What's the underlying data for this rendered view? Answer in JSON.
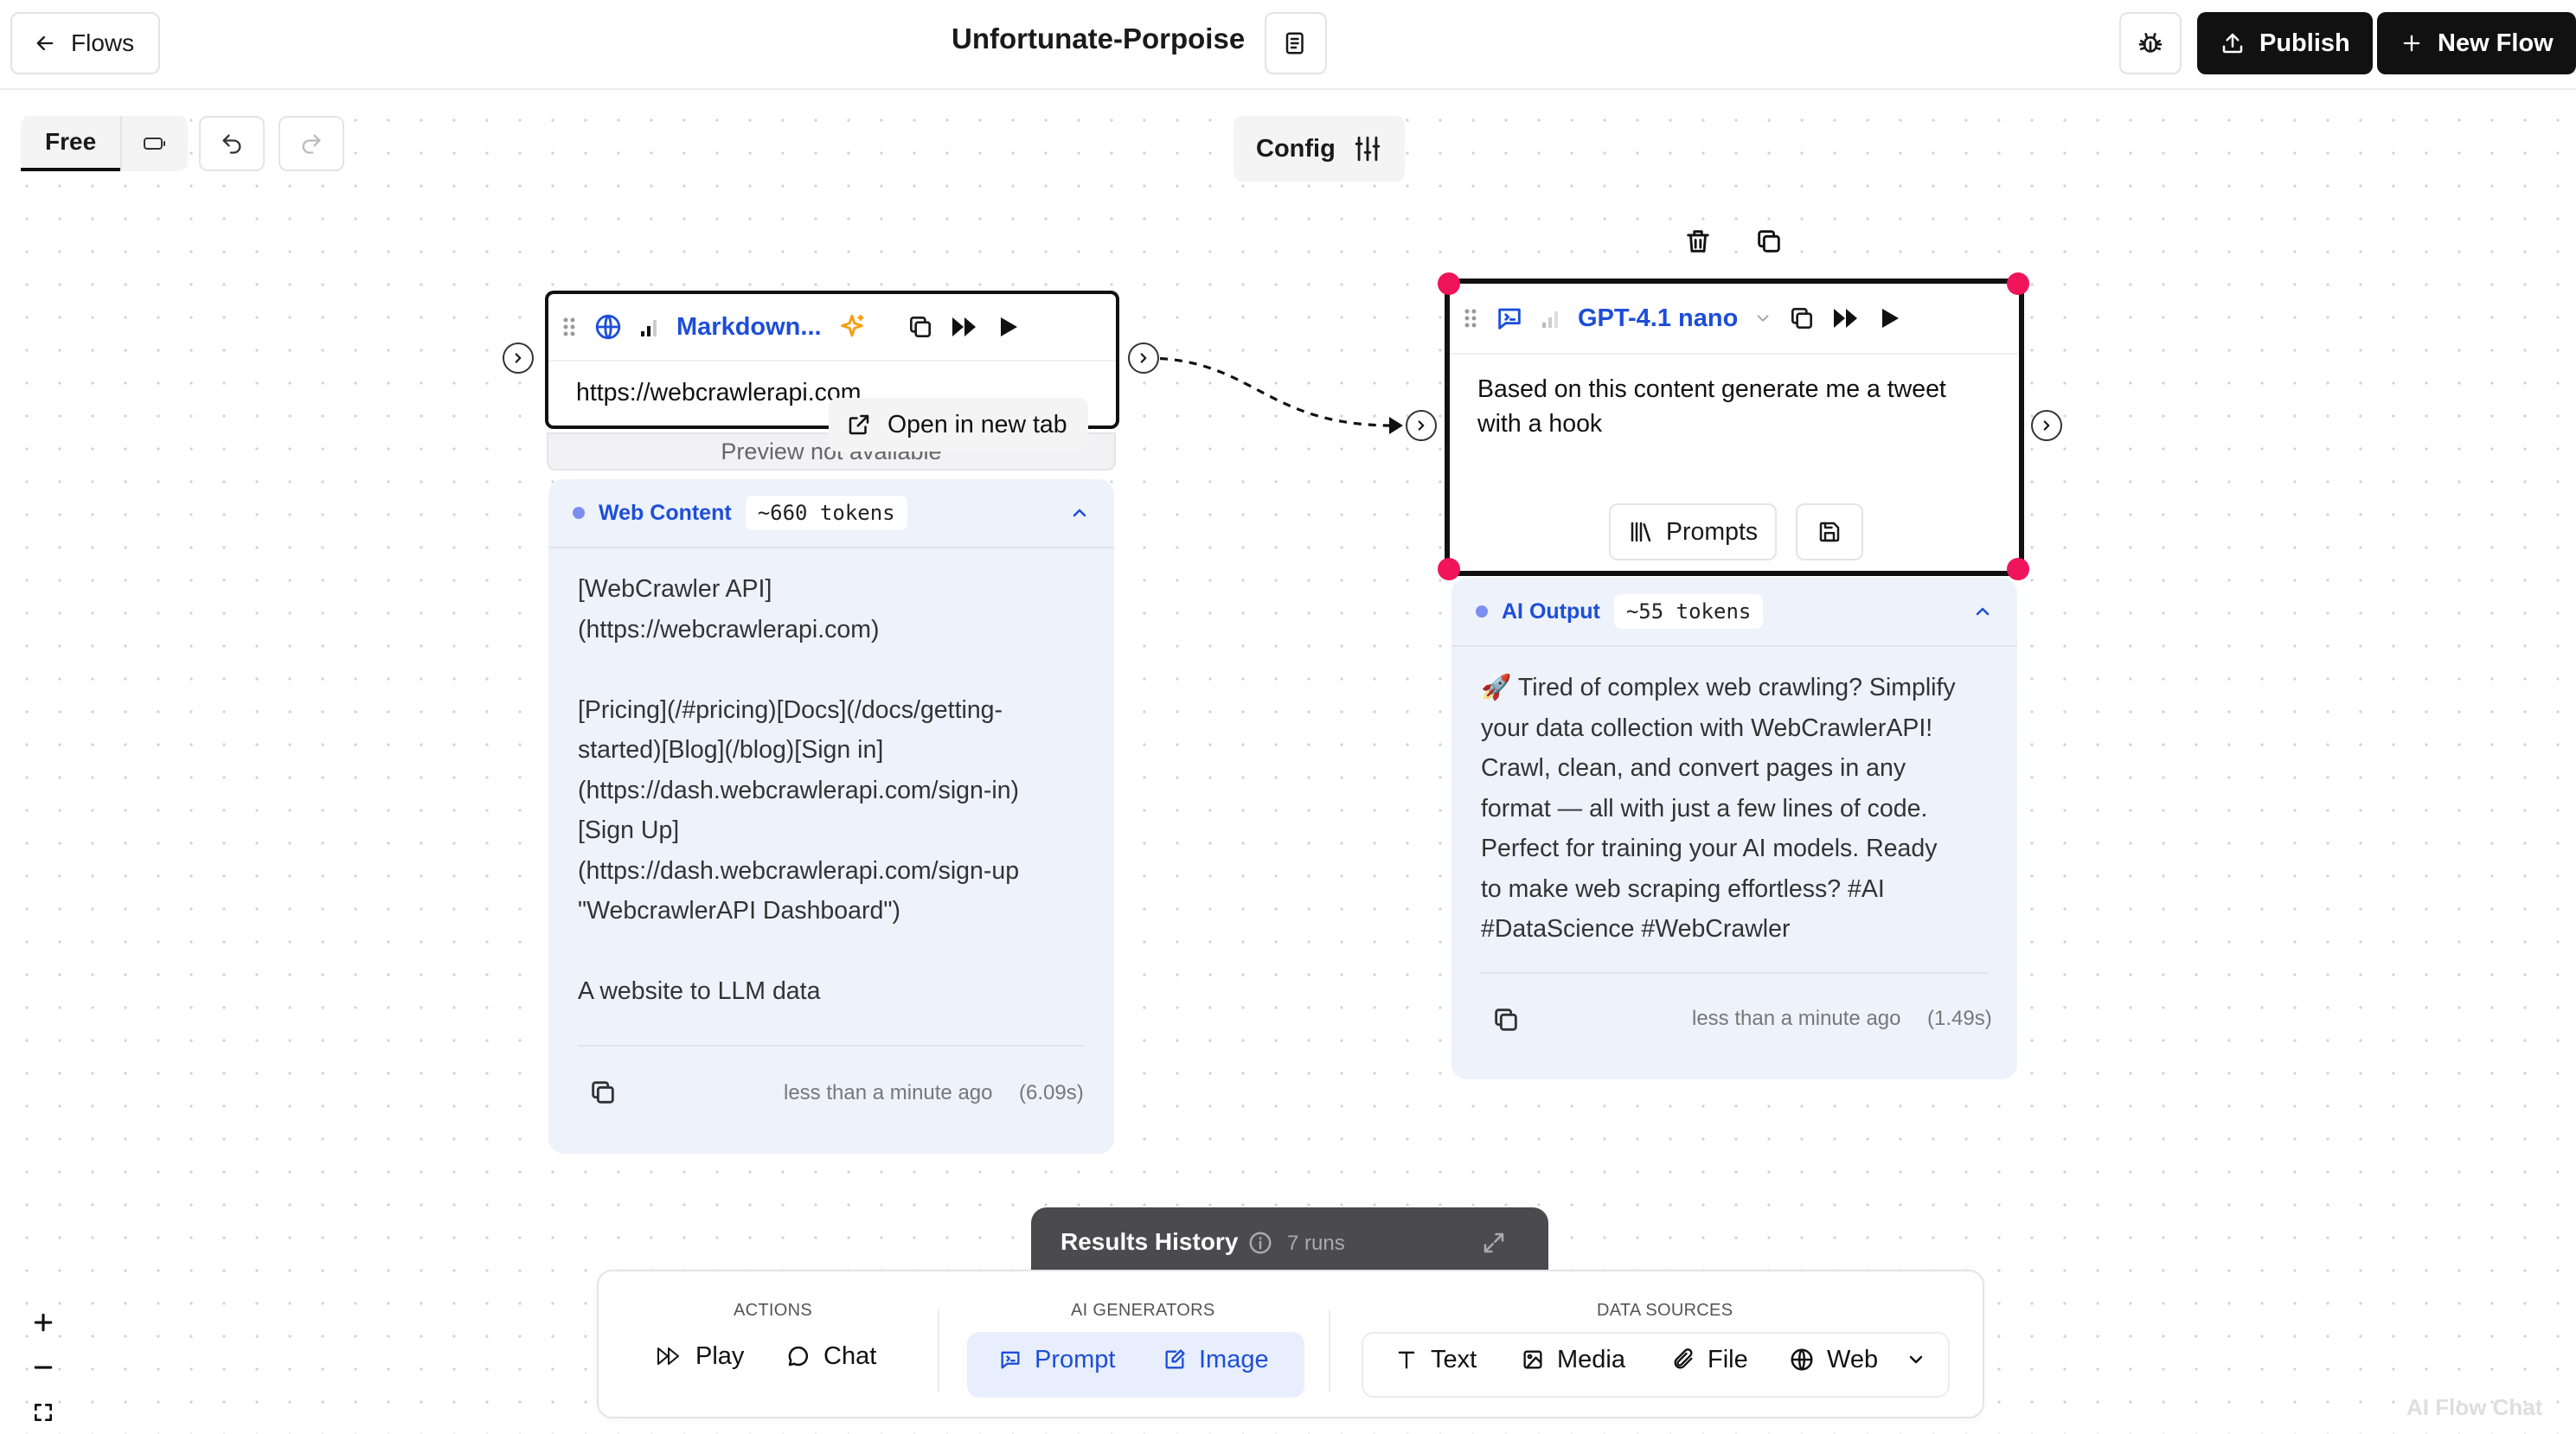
{
  "header": {
    "back_label": "Flows",
    "title": "Unfortunate-Porpoise",
    "publish_label": "Publish",
    "new_flow_label": "New Flow"
  },
  "toolbar": {
    "mode_label": "Free",
    "config_label": "Config"
  },
  "web_node": {
    "title": "Markdown...",
    "url": "https://webcrawlerapi.com",
    "open_tab_label": "Open in new tab",
    "preview_text": "Preview not available",
    "panel_label": "Web Content",
    "tokens": "~660 tokens",
    "content": "[WebCrawler API]\n(https://webcrawlerapi.com)\n\n[Pricing](/#pricing)[Docs](/docs/getting-\nstarted)[Blog](/blog)[Sign in]\n(https://dash.webcrawlerapi.com/sign-in)\n[Sign Up]\n(https://dash.webcrawlerapi.com/sign-up\n\"WebcrawlerAPI Dashboard\")\n\nA website to LLM data",
    "timestamp": "less than a minute ago",
    "duration": "(6.09s)"
  },
  "gpt_node": {
    "model": "GPT-4.1 nano",
    "prompt": "Based on this content generate me a tweet\nwith a hook",
    "prompts_label": "Prompts",
    "panel_label": "AI Output",
    "tokens": "~55 tokens",
    "content": "🚀 Tired of complex web crawling? Simplify\nyour data collection with WebCrawlerAPI!\nCrawl, clean, and convert pages in any\nformat — all with just a few lines of code.\nPerfect for training your AI models. Ready\nto make web scraping effortless? #AI\n#DataScience #WebCrawler",
    "timestamp": "less than a minute ago",
    "duration": "(1.49s)"
  },
  "results_history": {
    "label": "Results History",
    "runs": "7 runs"
  },
  "bottom_toolbar": {
    "actions_label": "ACTIONS",
    "play_label": "Play",
    "chat_label": "Chat",
    "ai_label": "AI GENERATORS",
    "prompt_label": "Prompt",
    "image_label": "Image",
    "data_label": "DATA SOURCES",
    "text_label": "Text",
    "media_label": "Media",
    "file_label": "File",
    "web_label": "Web"
  },
  "watermark": "AI Flow Chat",
  "colors": {
    "accent_blue": "#1d4ed8",
    "selection_pink": "#f0145a",
    "panel_bg": "#eef2fb",
    "dark_button": "#111111"
  }
}
